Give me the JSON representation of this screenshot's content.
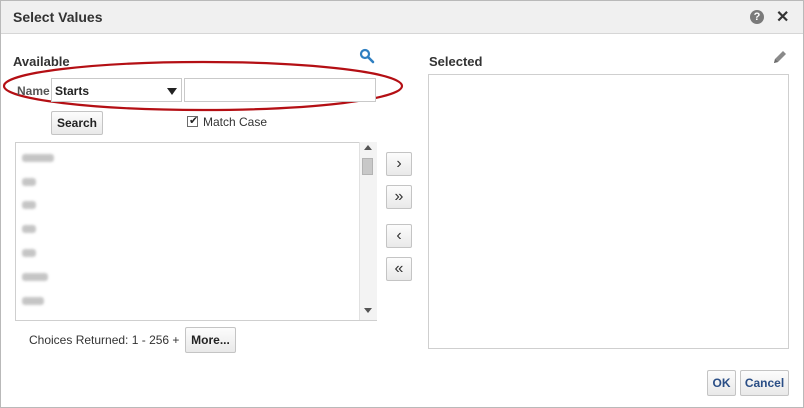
{
  "dialog": {
    "title": "Select Values",
    "help_icon_glyph": "?",
    "close_icon_glyph": "✕"
  },
  "available": {
    "heading": "Available",
    "search_icon": "search-icon",
    "name_label": "Name",
    "operator_value": "Starts",
    "value_input": "",
    "search_button": "Search",
    "match_case_label": "Match Case",
    "match_case_checked": true,
    "list_items_redacted": 7,
    "choices_returned_label": "Choices Returned:",
    "choices_returned_range": "1 - 256 +",
    "more_button": "More..."
  },
  "shuttle": {
    "move_glyph": "›",
    "move_all_glyph": "»",
    "remove_glyph": "‹",
    "remove_all_glyph": "«"
  },
  "selected": {
    "heading": "Selected",
    "edit_icon": "pencil-icon",
    "items": []
  },
  "footer": {
    "ok_label": "OK",
    "cancel_label": "Cancel"
  },
  "colors": {
    "highlight_ellipse": "#b40f14",
    "search_icon": "#2f7fc1",
    "action_text": "#2a4e86"
  }
}
